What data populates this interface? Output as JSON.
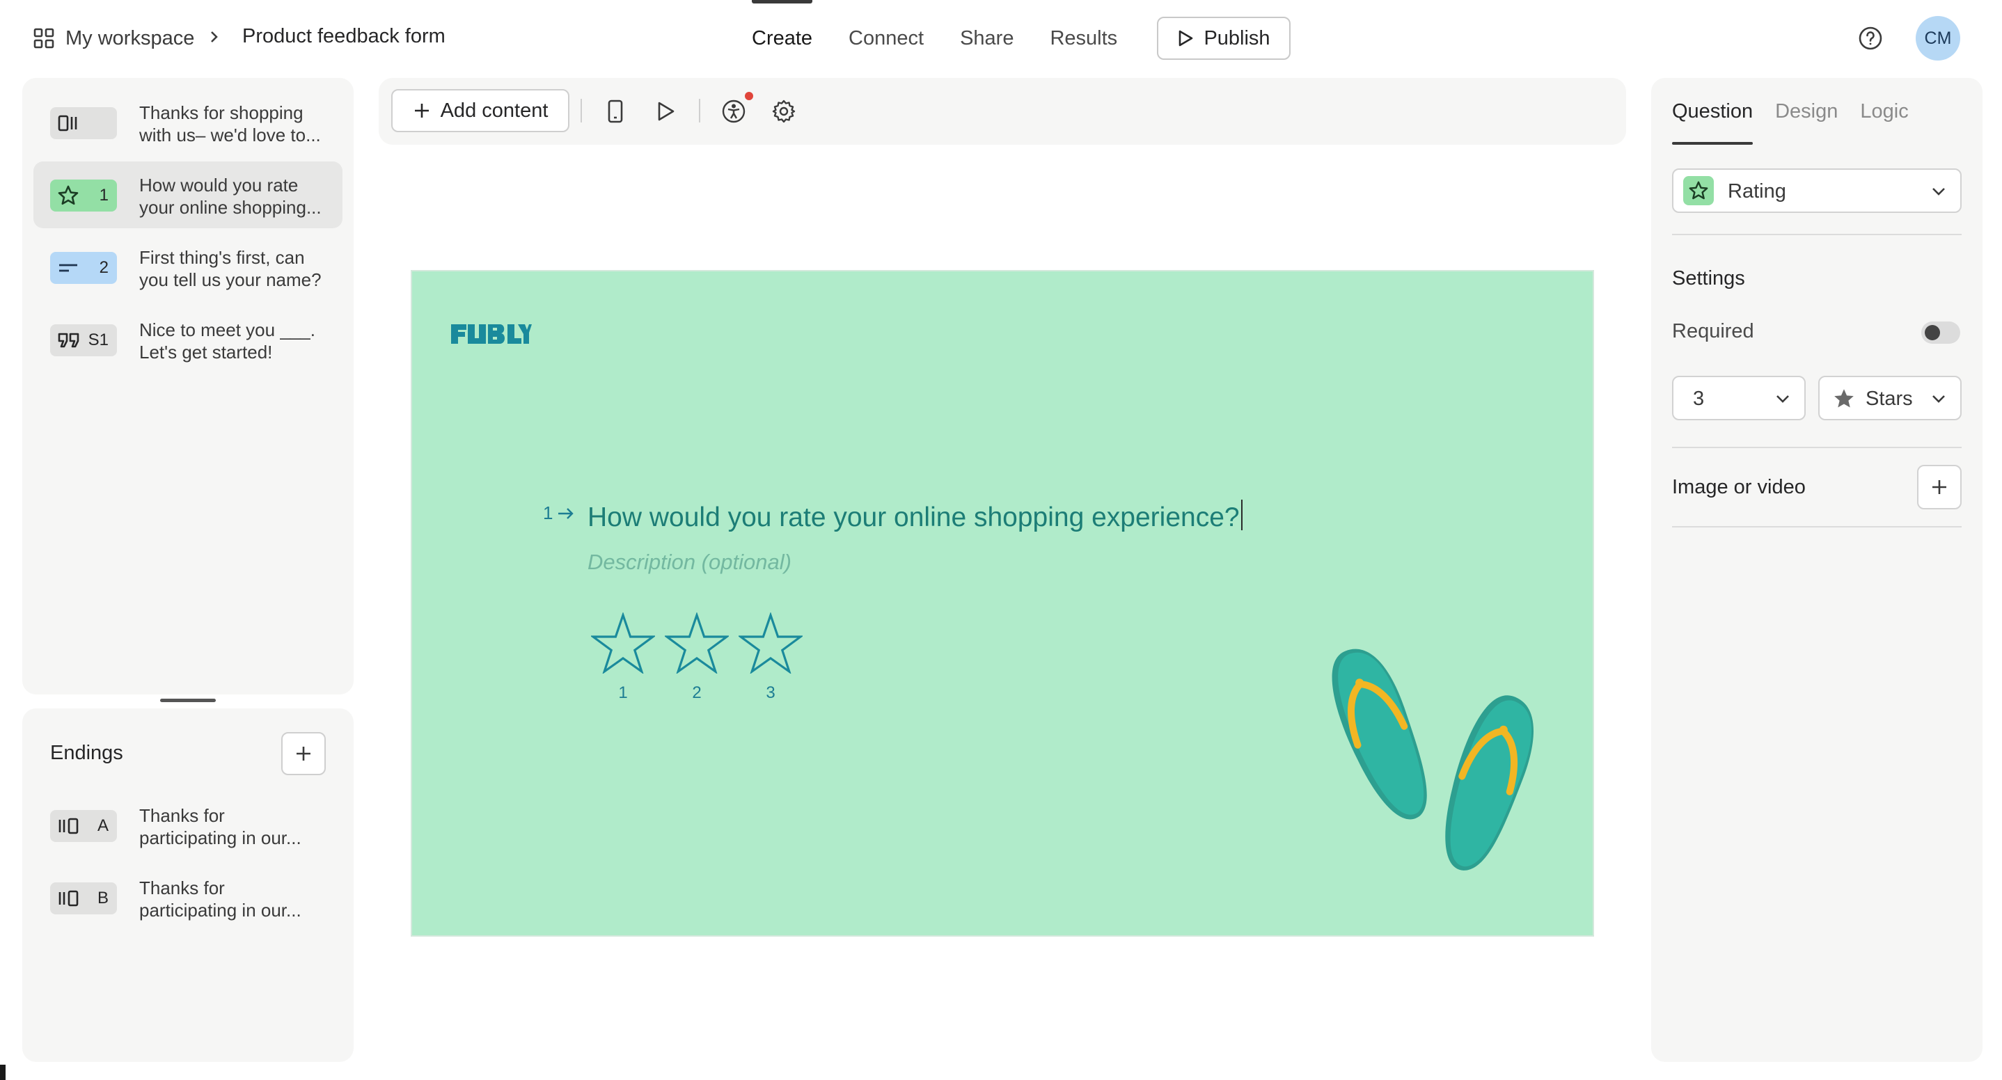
{
  "header": {
    "workspace": "My workspace",
    "form_name": "Product feedback form",
    "nav": [
      "Create",
      "Connect",
      "Share",
      "Results"
    ],
    "publish": "Publish",
    "avatar": "CM"
  },
  "questions": [
    {
      "type_icon": "welcome-screen-icon",
      "number": "",
      "text_line1": "Thanks for shopping",
      "text_line2": "with us– we'd love to...",
      "badge_color": "#e1e1e0",
      "selected": false
    },
    {
      "type_icon": "star-icon",
      "number": "1",
      "text_line1": "How would you rate",
      "text_line2": "your online shopping...",
      "badge_color": "#93dfa5",
      "selected": true
    },
    {
      "type_icon": "short-text-icon",
      "number": "2",
      "text_line1": "First thing's first, can",
      "text_line2": "you tell us your name?",
      "badge_color": "#b5d8f7",
      "selected": false
    },
    {
      "type_icon": "quote-icon",
      "number": "S1",
      "text_line1": "Nice to meet you ___.",
      "text_line2": "Let's get started!",
      "badge_color": "#e1e1e0",
      "selected": false
    }
  ],
  "endings": {
    "title": "Endings",
    "items": [
      {
        "letter": "A",
        "text_line1": "Thanks for",
        "text_line2": "participating in our..."
      },
      {
        "letter": "B",
        "text_line1": "Thanks for",
        "text_line2": "participating in our..."
      }
    ]
  },
  "toolbar": {
    "add_content": "Add content"
  },
  "canvas": {
    "background": "#b0ebca",
    "number": "1",
    "question": "How would you rate your online shopping experience?",
    "description_placeholder": "Description (optional)",
    "star_labels": [
      "1",
      "2",
      "3"
    ]
  },
  "right_panel": {
    "tabs": [
      "Question",
      "Design",
      "Logic"
    ],
    "question_type": "Rating",
    "settings_title": "Settings",
    "required_label": "Required",
    "required": false,
    "steps_value": "3",
    "shape_value": "Stars",
    "image_or_video": "Image or video"
  },
  "colors": {
    "accent_teal": "#1d7d93",
    "question_text": "#1c7d76",
    "rating_badge": "#93dfa5",
    "notification_dot": "#e0453b"
  }
}
